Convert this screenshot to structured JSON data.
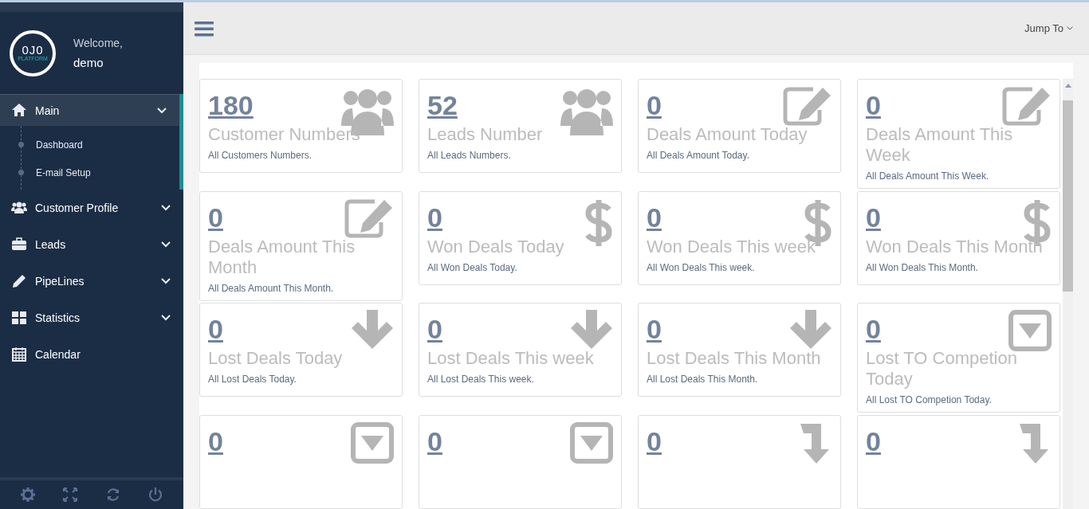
{
  "sidebar": {
    "logo": {
      "mark": "0J0",
      "caption": "PLATFORM"
    },
    "welcome": "Welcome,",
    "user": "demo",
    "items": [
      {
        "label": "Main",
        "kind": "home",
        "expanded": true,
        "selected": true,
        "has_caret": true,
        "children": [
          {
            "label": "Dashboard"
          },
          {
            "label": "E-mail Setup"
          }
        ]
      },
      {
        "label": "Customer Profile",
        "kind": "users",
        "expanded": false,
        "selected": false,
        "has_caret": true
      },
      {
        "label": "Leads",
        "kind": "briefcase",
        "expanded": false,
        "selected": false,
        "has_caret": true
      },
      {
        "label": "PipeLines",
        "kind": "pencil",
        "expanded": false,
        "selected": false,
        "has_caret": true
      },
      {
        "label": "Statistics",
        "kind": "grid",
        "expanded": false,
        "selected": false,
        "has_caret": true
      },
      {
        "label": "Calendar",
        "kind": "calendar",
        "selected": false,
        "has_caret": false
      }
    ],
    "footer_buttons": [
      {
        "kind": "settings"
      },
      {
        "kind": "fullscreen"
      },
      {
        "kind": "refresh"
      },
      {
        "kind": "power"
      }
    ]
  },
  "topbar": {
    "jump_to": "Jump To"
  },
  "cards": [
    {
      "kind": "users",
      "value": "180",
      "title": "Customer Numbers",
      "subtitle": "All Customers Numbers."
    },
    {
      "kind": "users",
      "value": "52",
      "title": "Leads Number",
      "subtitle": "All Leads Numbers."
    },
    {
      "kind": "edit",
      "value": "0",
      "title": "Deals Amount Today",
      "subtitle": "All Deals Amount Today."
    },
    {
      "kind": "edit",
      "value": "0",
      "title": "Deals Amount This Week",
      "subtitle": "All Deals Amount This Week."
    },
    {
      "kind": "edit",
      "value": "0",
      "title": "Deals Amount This Month",
      "subtitle": "All Deals Amount This Month."
    },
    {
      "kind": "dollar",
      "value": "0",
      "title": "Won Deals Today",
      "subtitle": "All Won Deals Today."
    },
    {
      "kind": "dollar",
      "value": "0",
      "title": "Won Deals This week",
      "subtitle": "All Won Deals This week."
    },
    {
      "kind": "dollar",
      "value": "0",
      "title": "Won Deals This Month",
      "subtitle": "All Won Deals This Month."
    },
    {
      "kind": "arrow-down",
      "value": "0",
      "title": "Lost Deals Today",
      "subtitle": "All Lost Deals Today."
    },
    {
      "kind": "arrow-down",
      "value": "0",
      "title": "Lost Deals This week",
      "subtitle": "All Lost Deals This week."
    },
    {
      "kind": "arrow-down",
      "value": "0",
      "title": "Lost Deals This Month",
      "subtitle": "All Lost Deals This Month."
    },
    {
      "kind": "caret-square",
      "value": "0",
      "title": "Lost TO Competion Today",
      "subtitle": "All Lost TO Competion Today."
    },
    {
      "kind": "caret-square",
      "value": "0"
    },
    {
      "kind": "caret-square",
      "value": "0"
    },
    {
      "kind": "level-down",
      "value": "0"
    },
    {
      "kind": "level-down",
      "value": "0"
    }
  ]
}
